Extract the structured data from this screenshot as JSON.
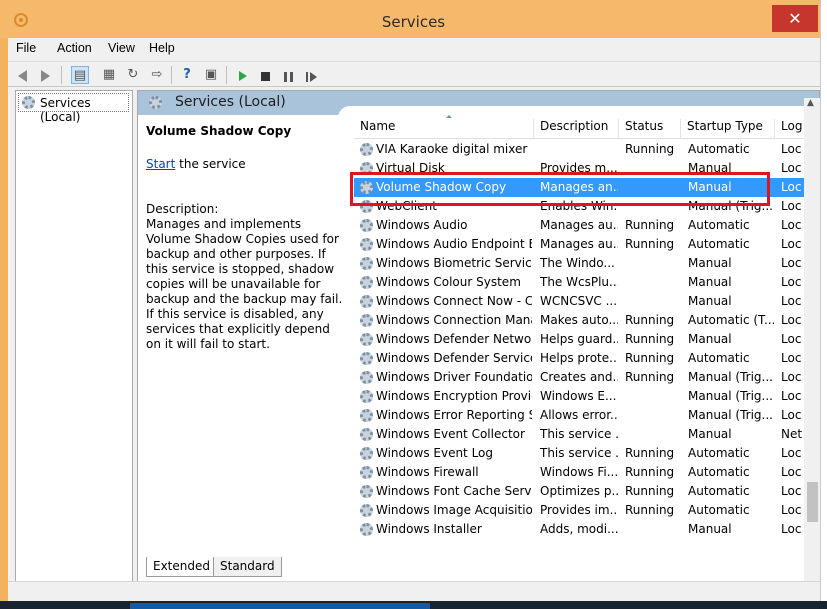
{
  "window": {
    "title": "Services",
    "close_glyph": "✕"
  },
  "menubar": {
    "items": [
      "File",
      "Action",
      "View",
      "Help"
    ]
  },
  "toolbar": {
    "buttons": [
      "back-icon",
      "forward-icon",
      "console-tree-icon",
      "properties-icon",
      "refresh-icon",
      "export-icon",
      "help-icon",
      "view-icon",
      "start-icon",
      "stop-icon",
      "pause-icon",
      "resume-icon"
    ]
  },
  "tree": {
    "root_label": "Services (Local)"
  },
  "main": {
    "header_title": "Services (Local)",
    "selected_name": "Volume Shadow Copy",
    "start_link": "Start",
    "start_suffix": " the service",
    "description_label": "Description:",
    "description_text": "Manages and implements Volume Shadow Copies used for backup and other purposes. If this service is stopped, shadow copies will be unavailable for backup and the backup may fail. If this service is disabled, any services that explicitly depend on it will fail to start."
  },
  "list": {
    "columns": [
      "Name",
      "Description",
      "Status",
      "Startup Type",
      "Log"
    ],
    "rows": [
      {
        "name": "VIA Karaoke digital mixer Se...",
        "description": "",
        "status": "Running",
        "startup": "Automatic",
        "log": "Loc"
      },
      {
        "name": "Virtual Disk",
        "description": "Provides m...",
        "status": "",
        "startup": "Manual",
        "log": "Loc"
      },
      {
        "name": "Volume Shadow Copy",
        "description": "Manages an...",
        "status": "",
        "startup": "Manual",
        "log": "Loc",
        "selected": true
      },
      {
        "name": "WebClient",
        "description": "Enables Win...",
        "status": "",
        "startup": "Manual (Trig...",
        "log": "Loc"
      },
      {
        "name": "Windows Audio",
        "description": "Manages au...",
        "status": "Running",
        "startup": "Automatic",
        "log": "Loc"
      },
      {
        "name": "Windows Audio Endpoint B...",
        "description": "Manages au...",
        "status": "Running",
        "startup": "Automatic",
        "log": "Loc"
      },
      {
        "name": "Windows Biometric Service",
        "description": "The Windo...",
        "status": "",
        "startup": "Manual",
        "log": "Loc"
      },
      {
        "name": "Windows Colour System",
        "description": "The WcsPlu...",
        "status": "",
        "startup": "Manual",
        "log": "Loc"
      },
      {
        "name": "Windows Connect Now - C...",
        "description": "WCNCSVC ...",
        "status": "",
        "startup": "Manual",
        "log": "Loc"
      },
      {
        "name": "Windows Connection Mana...",
        "description": "Makes auto...",
        "status": "Running",
        "startup": "Automatic (T...",
        "log": "Loc"
      },
      {
        "name": "Windows Defender Networ...",
        "description": "Helps guard...",
        "status": "Running",
        "startup": "Manual",
        "log": "Loc"
      },
      {
        "name": "Windows Defender Service",
        "description": "Helps prote...",
        "status": "Running",
        "startup": "Automatic",
        "log": "Loc"
      },
      {
        "name": "Windows Driver Foundation...",
        "description": "Creates and...",
        "status": "Running",
        "startup": "Manual (Trig...",
        "log": "Loc"
      },
      {
        "name": "Windows Encryption Provid...",
        "description": "Windows E...",
        "status": "",
        "startup": "Manual (Trig...",
        "log": "Loc"
      },
      {
        "name": "Windows Error Reporting Se...",
        "description": "Allows error...",
        "status": "",
        "startup": "Manual (Trig...",
        "log": "Loc"
      },
      {
        "name": "Windows Event Collector",
        "description": "This service ...",
        "status": "",
        "startup": "Manual",
        "log": "Net"
      },
      {
        "name": "Windows Event Log",
        "description": "This service ...",
        "status": "Running",
        "startup": "Automatic",
        "log": "Loc"
      },
      {
        "name": "Windows Firewall",
        "description": "Windows Fi...",
        "status": "Running",
        "startup": "Automatic",
        "log": "Loc"
      },
      {
        "name": "Windows Font Cache Service",
        "description": "Optimizes p...",
        "status": "Running",
        "startup": "Automatic",
        "log": "Loc"
      },
      {
        "name": "Windows Image Acquisitio...",
        "description": "Provides im...",
        "status": "Running",
        "startup": "Automatic",
        "log": "Loc"
      },
      {
        "name": "Windows Installer",
        "description": "Adds, modi...",
        "status": "",
        "startup": "Manual",
        "log": "Loc"
      }
    ]
  },
  "tabs": [
    "Extended",
    "Standard"
  ],
  "colors": {
    "accent": "#3399ff",
    "highlight": "#e0141e",
    "header": "#a9c3db"
  }
}
